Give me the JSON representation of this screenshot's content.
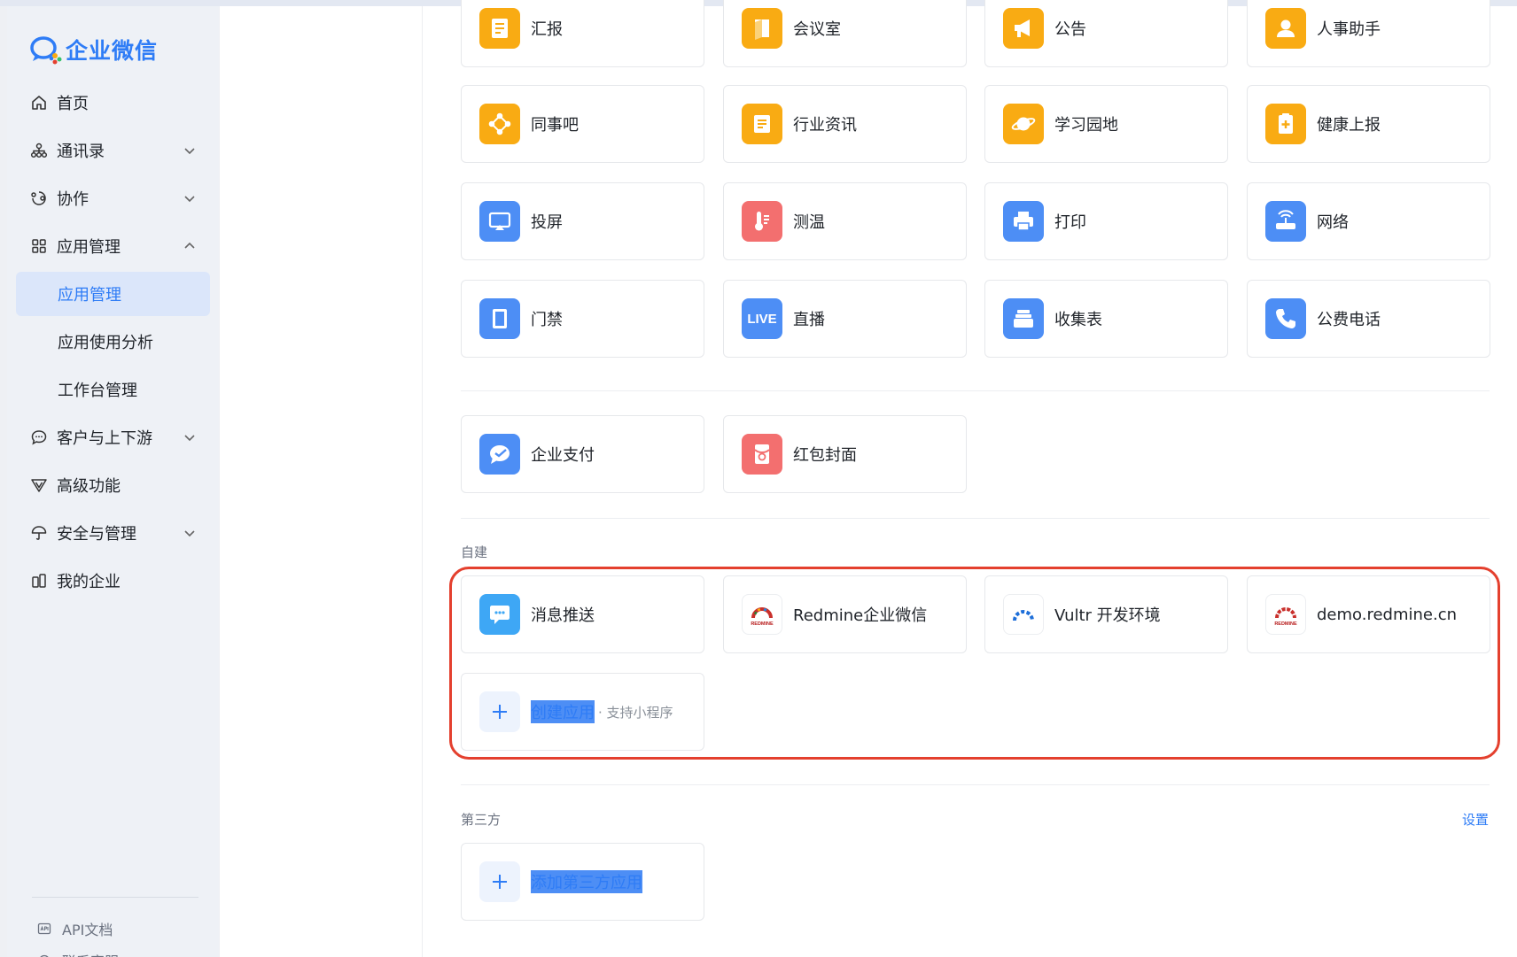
{
  "brand": {
    "name": "企业微信"
  },
  "sidebar": {
    "items": [
      {
        "label": "首页",
        "icon": "home-icon"
      },
      {
        "label": "通讯录",
        "icon": "org-chart-icon",
        "expandable": true
      },
      {
        "label": "协作",
        "icon": "collaborate-icon",
        "expandable": true
      },
      {
        "label": "应用管理",
        "icon": "apps-grid-icon",
        "expanded": true
      },
      {
        "label": "应用管理",
        "sub": true,
        "active": true
      },
      {
        "label": "应用使用分析",
        "sub": true
      },
      {
        "label": "工作台管理",
        "sub": true
      },
      {
        "label": "客户与上下游",
        "icon": "chat-bubble-icon",
        "expandable": true
      },
      {
        "label": "高级功能",
        "icon": "v-badge-icon"
      },
      {
        "label": "安全与管理",
        "icon": "umbrella-icon",
        "expandable": true
      },
      {
        "label": "我的企业",
        "icon": "building-icon"
      }
    ],
    "bottom": [
      {
        "label": "API文档",
        "icon": "api-doc-icon"
      },
      {
        "label": "联系客服",
        "icon": "headset-icon"
      }
    ]
  },
  "apps": {
    "row1": [
      "汇报",
      "会议室",
      "公告",
      "人事助手"
    ],
    "row2": [
      "同事吧",
      "行业资讯",
      "学习园地",
      "健康上报"
    ],
    "row3": [
      "投屏",
      "测温",
      "打印",
      "网络"
    ],
    "row4": [
      "门禁",
      "直播",
      "收集表",
      "公费电话"
    ],
    "row5": [
      "企业支付",
      "红包封面"
    ],
    "live_badge": "LIVE"
  },
  "custom": {
    "section_label": "自建",
    "apps": [
      "消息推送",
      "Redmine企业微信",
      "Vultr 开发环境",
      "demo.redmine.cn"
    ],
    "redmine_logo_text": "REDMINE",
    "create_label": "创建应用",
    "create_sub": "· 支持小程序"
  },
  "third_party": {
    "section_label": "第三方",
    "settings_label": "设置",
    "add_label": "添加第三方应用"
  },
  "colors": {
    "accent": "#2e7cf6",
    "orange": "#f9ab13",
    "blue": "#4d8ef5",
    "red": "#f36f6f",
    "highlight": "#e4402e"
  }
}
